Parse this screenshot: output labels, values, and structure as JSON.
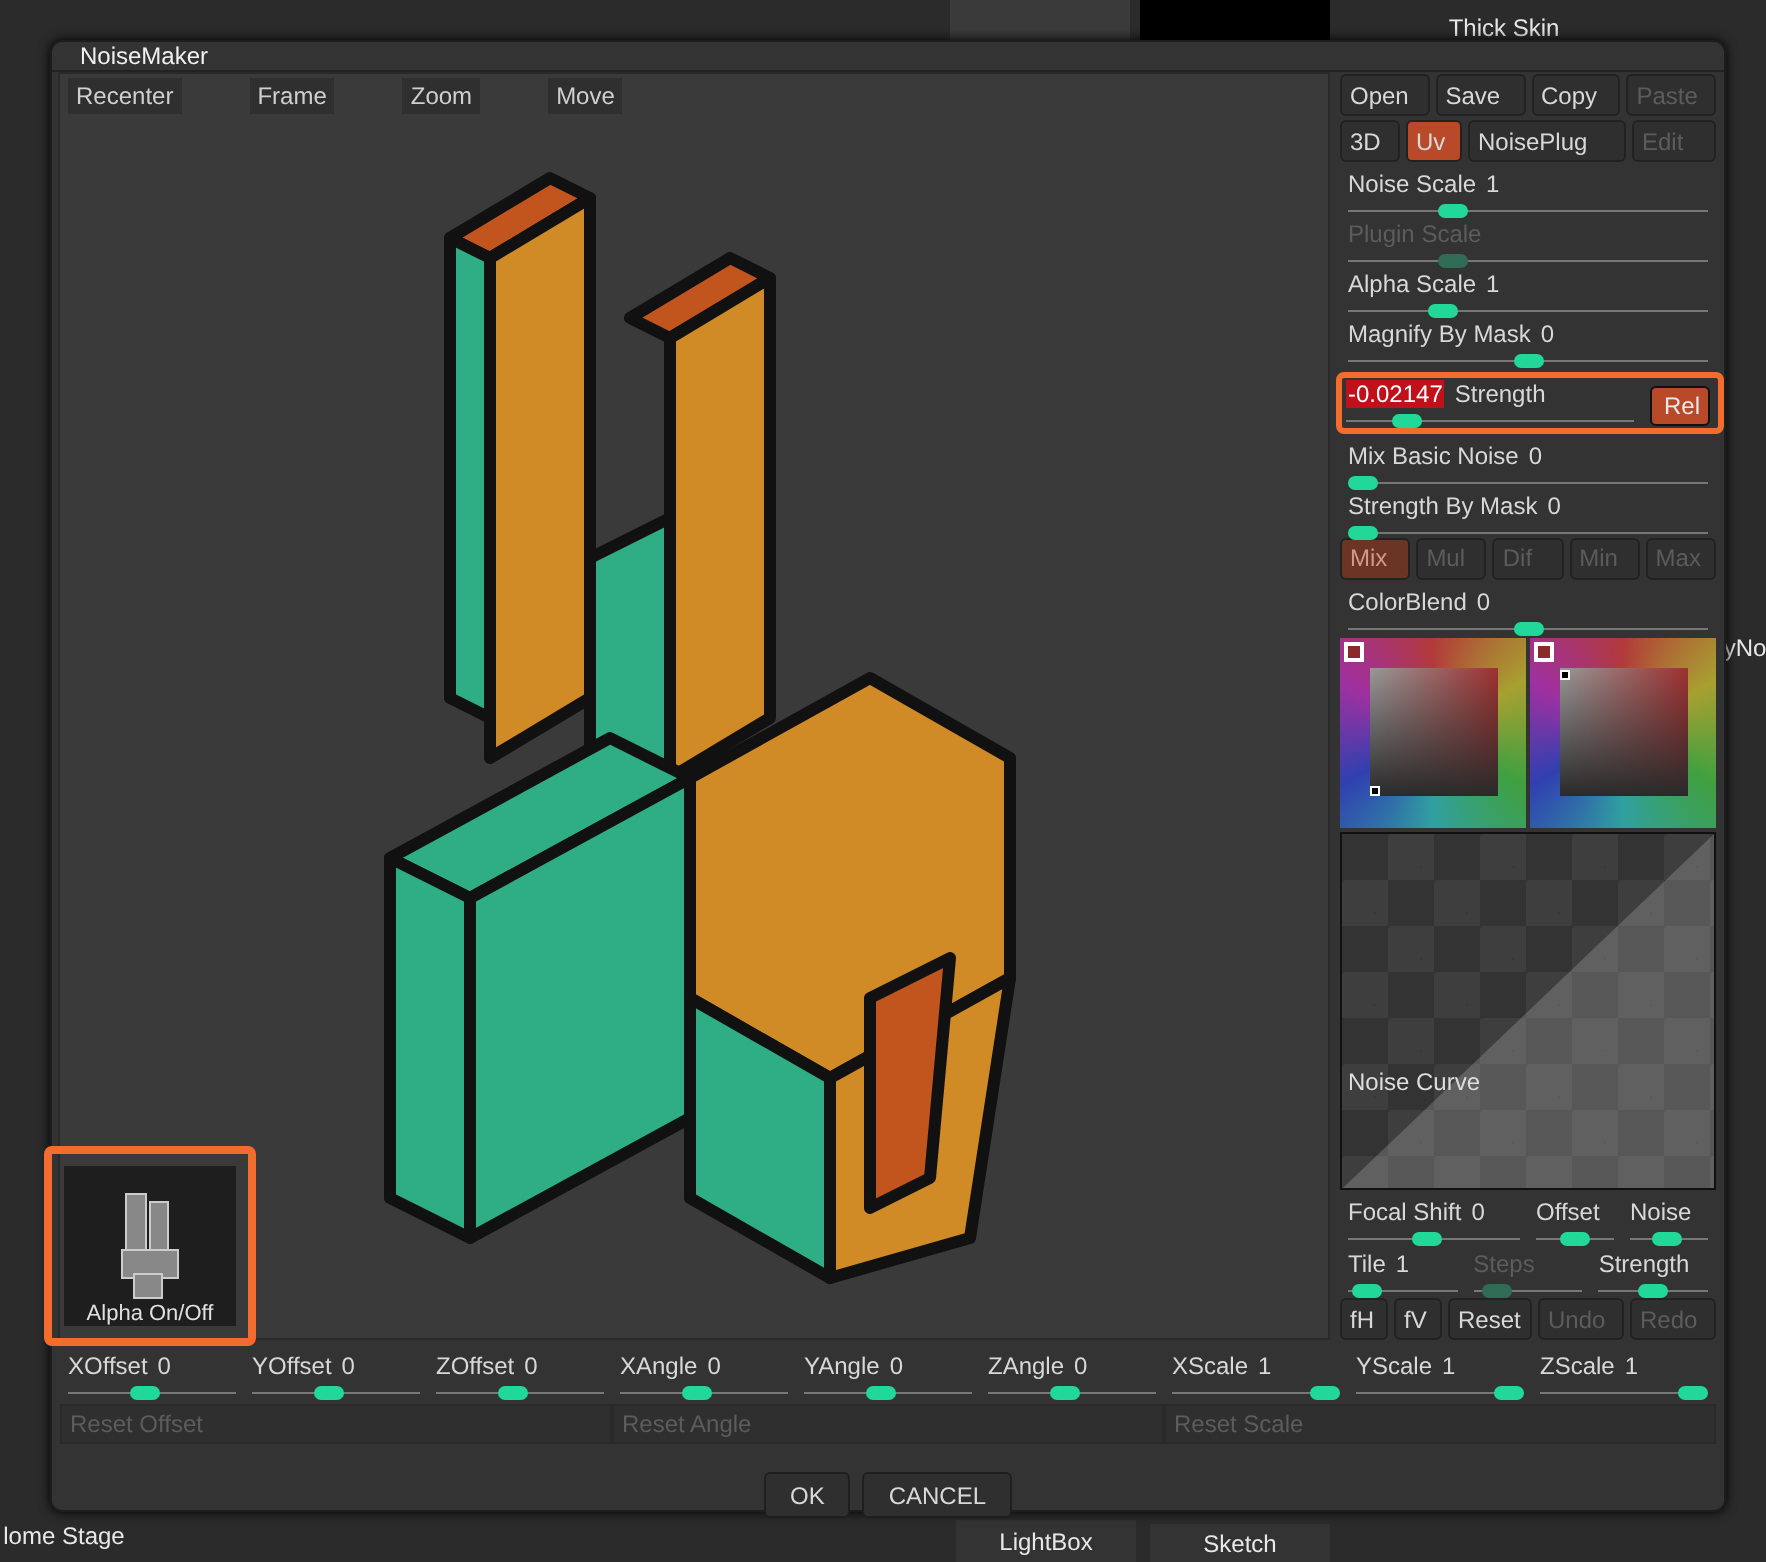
{
  "background": {
    "material_title": "Thick Skin",
    "bottom_left_label": "lome Stage",
    "right_edge_label": "yNo",
    "lightbox_label": "LightBox",
    "sketch_label": "Sketch"
  },
  "dialog": {
    "title": "NoiseMaker"
  },
  "viewport": {
    "toolbar": [
      "Recenter",
      "Frame",
      "Zoom",
      "Move"
    ],
    "alpha": {
      "label": "Alpha On/Off",
      "highlighted": true
    }
  },
  "panel": {
    "file_buttons": [
      {
        "label": "Open",
        "disabled": false
      },
      {
        "label": "Save",
        "disabled": false
      },
      {
        "label": "Copy",
        "disabled": false
      },
      {
        "label": "Paste",
        "disabled": true
      }
    ],
    "mode_buttons": [
      {
        "label": "3D",
        "selected": false,
        "disabled": false
      },
      {
        "label": "Uv",
        "selected": true,
        "disabled": false
      },
      {
        "label": "NoisePlug",
        "selected": false,
        "disabled": false
      },
      {
        "label": "Edit",
        "selected": false,
        "disabled": true
      }
    ],
    "sliders_top": [
      {
        "label": "Noise Scale",
        "value": "1",
        "level": 0.27,
        "disabled": false
      },
      {
        "label": "Plugin Scale",
        "level": 0.27,
        "disabled": true
      },
      {
        "label": "Alpha Scale",
        "value": "1",
        "level": 0.24,
        "disabled": false
      },
      {
        "label": "Magnify By Mask",
        "value": "0",
        "level": 0.5,
        "disabled": false
      }
    ],
    "strength": {
      "value": "-0.02147",
      "label": "Strength",
      "level": 0.18,
      "highlighted": true,
      "rel": {
        "label": "Rel",
        "on": true
      }
    },
    "sliders_mid": [
      {
        "label": "Mix Basic Noise",
        "value": "0",
        "level": 0.0,
        "disabled": false
      },
      {
        "label": "Strength By Mask",
        "value": "0",
        "level": 0.0,
        "disabled": false
      }
    ],
    "blend_modes": [
      {
        "label": "Mix",
        "selected": true
      },
      {
        "label": "Mul",
        "selected": false
      },
      {
        "label": "Dif",
        "selected": false
      },
      {
        "label": "Min",
        "selected": false
      },
      {
        "label": "Max",
        "selected": false
      }
    ],
    "color_blend": {
      "label": "ColorBlend",
      "value": "0",
      "level": 0.5,
      "disabled": false
    },
    "curve": {
      "label": "Noise Curve"
    },
    "row_a": [
      {
        "label": "Focal Shift",
        "value": "0",
        "level": 0.45,
        "disabled": false
      },
      {
        "label": "Offset",
        "level": 0.5,
        "disabled": false
      },
      {
        "label": "Noise",
        "level": 0.45,
        "disabled": false
      }
    ],
    "row_b": [
      {
        "label": "Tile",
        "value": "1",
        "level": 0.05,
        "disabled": false
      },
      {
        "label": "Steps",
        "level": 0.1,
        "disabled": true
      },
      {
        "label": "Strength",
        "level": 0.5,
        "disabled": false
      }
    ],
    "edit_buttons": [
      {
        "label": "fH",
        "disabled": false
      },
      {
        "label": "fV",
        "disabled": false
      },
      {
        "label": "Reset",
        "disabled": false
      },
      {
        "label": "Undo",
        "disabled": true
      },
      {
        "label": "Redo",
        "disabled": true
      }
    ]
  },
  "transform_sliders": [
    {
      "label": "XOffset",
      "value": "0",
      "level": 0.45
    },
    {
      "label": "YOffset",
      "value": "0",
      "level": 0.45
    },
    {
      "label": "ZOffset",
      "value": "0",
      "level": 0.45
    },
    {
      "label": "XAngle",
      "value": "0",
      "level": 0.45
    },
    {
      "label": "YAngle",
      "value": "0",
      "level": 0.45
    },
    {
      "label": "ZAngle",
      "value": "0",
      "level": 0.45
    },
    {
      "label": "XScale",
      "value": "1",
      "level": 1
    },
    {
      "label": "YScale",
      "value": "1",
      "level": 1
    },
    {
      "label": "ZScale",
      "value": "1",
      "level": 1
    }
  ],
  "reset_buttons": [
    {
      "label": "Reset Offset",
      "disabled": true
    },
    {
      "label": "Reset Angle",
      "disabled": true
    },
    {
      "label": "Reset Scale",
      "disabled": true
    }
  ],
  "footer": [
    "OK",
    "CANCEL"
  ]
}
